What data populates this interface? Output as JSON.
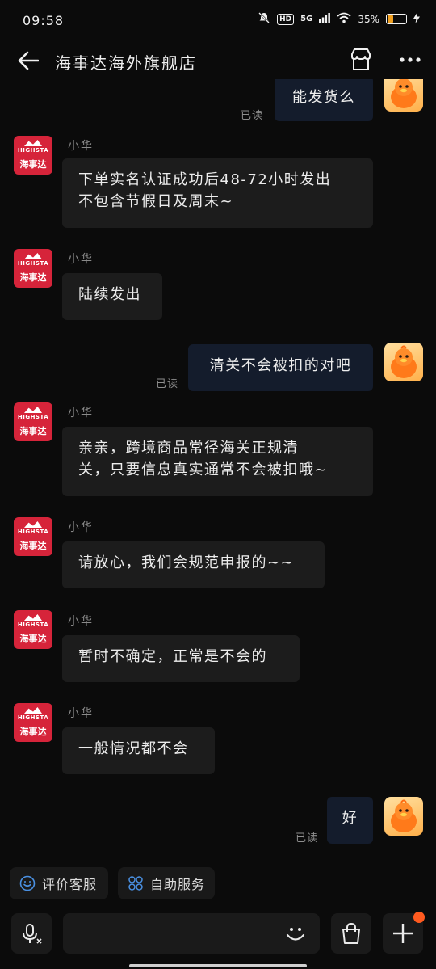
{
  "status_bar": {
    "time": "09:58",
    "hd": "HD",
    "network": "5G",
    "battery": "35%",
    "battery_level": 0.35
  },
  "header": {
    "title": "海事达海外旗舰店"
  },
  "shop_avatar": {
    "brand_en": "HIGHSTA",
    "brand_cn": "海事达"
  },
  "messages": [
    {
      "side": "out",
      "text": "能发货么",
      "read": "已读"
    },
    {
      "side": "in",
      "sender": "小华",
      "text_lines": [
        "下单实名认证成功后48-72小时发出",
        "不包含节假日及周末~"
      ]
    },
    {
      "side": "in",
      "sender": "小华",
      "text": "陆续发出"
    },
    {
      "side": "out",
      "text": "清关不会被扣的对吧",
      "read": "已读"
    },
    {
      "side": "in",
      "sender": "小华",
      "text_lines": [
        "亲亲，跨境商品常径海关正规清",
        "关，只要信息真实通常不会被扣哦~"
      ]
    },
    {
      "side": "in",
      "sender": "小华",
      "text": "请放心，我们会规范申报的~~"
    },
    {
      "side": "in",
      "sender": "小华",
      "text": "暂时不确定，正常是不会的"
    },
    {
      "side": "in",
      "sender": "小华",
      "text": "一般情况都不会"
    },
    {
      "side": "out",
      "text": "好",
      "read": "已读"
    }
  ],
  "quick_actions": [
    {
      "label": "评价客服",
      "icon": "smiley-service-icon"
    },
    {
      "label": "自助服务",
      "icon": "grid-service-icon"
    }
  ],
  "input": {
    "placeholder": "",
    "value": ""
  },
  "colors": {
    "background": "#0b0b0b",
    "incoming_bubble": "#1c1c1c",
    "outgoing_bubble": "#141c2c",
    "shop_red": "#d6243a",
    "accent_blue": "#4a90e2",
    "notification_dot": "#ff5a1f"
  }
}
